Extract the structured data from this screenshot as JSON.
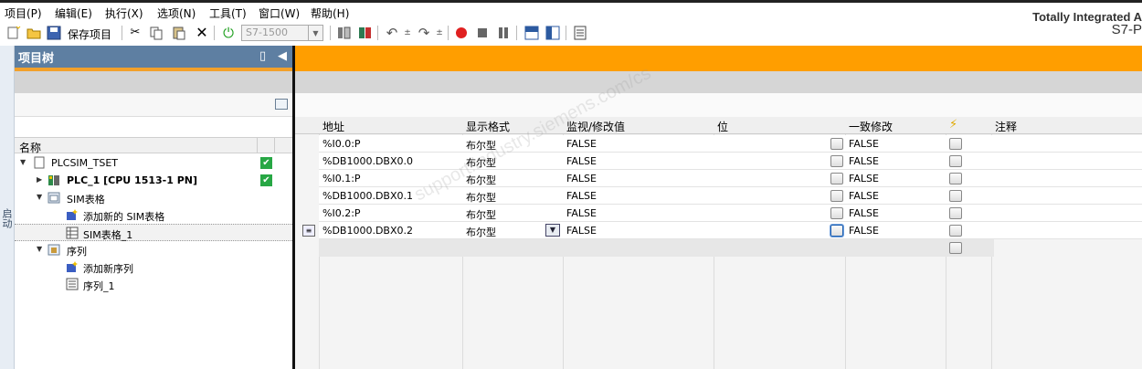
{
  "menubar": {
    "items": [
      "项目(P)",
      "编辑(E)",
      "执行(X)",
      "选项(N)",
      "工具(T)",
      "窗口(W)",
      "帮助(H)"
    ]
  },
  "brand": {
    "line1": "Totally Integrated A",
    "line2": "S7-P"
  },
  "toolbar": {
    "save_label": "保存项目",
    "device_select": "S7-1500"
  },
  "sidetab": {
    "label": "启动"
  },
  "project_tree": {
    "title": "项目树",
    "column_header": "名称",
    "items": [
      {
        "label": "PLCSIM_TSET",
        "level": 0,
        "expanded": true,
        "checked": true,
        "bold": false
      },
      {
        "label": "PLC_1 [CPU 1513-1 PN]",
        "level": 1,
        "expanded": false,
        "checked": true,
        "bold": true
      },
      {
        "label": "SIM表格",
        "level": 1,
        "expanded": true,
        "checked": false,
        "bold": false
      },
      {
        "label": "添加新的 SIM表格",
        "level": 2,
        "expanded": null,
        "checked": false,
        "bold": false
      },
      {
        "label": "SIM表格_1",
        "level": 2,
        "expanded": null,
        "checked": false,
        "bold": false,
        "selected": true
      },
      {
        "label": "序列",
        "level": 1,
        "expanded": true,
        "checked": false,
        "bold": false
      },
      {
        "label": "添加新序列",
        "level": 2,
        "expanded": null,
        "checked": false,
        "bold": false
      },
      {
        "label": "序列_1",
        "level": 2,
        "expanded": null,
        "checked": false,
        "bold": false
      }
    ]
  },
  "table": {
    "headers": {
      "address": "地址",
      "format": "显示格式",
      "monitor": "监视/修改值",
      "bit": "位",
      "consistent": "一致修改",
      "lightning": "⚡",
      "comment": "注释"
    },
    "rows": [
      {
        "address": "%I0.0:P",
        "format": "布尔型",
        "monitor": "FALSE",
        "consistent": "FALSE"
      },
      {
        "address": "%DB1000.DBX0.0",
        "format": "布尔型",
        "monitor": "FALSE",
        "consistent": "FALSE"
      },
      {
        "address": "%I0.1:P",
        "format": "布尔型",
        "monitor": "FALSE",
        "consistent": "FALSE"
      },
      {
        "address": "%DB1000.DBX0.1",
        "format": "布尔型",
        "monitor": "FALSE",
        "consistent": "FALSE"
      },
      {
        "address": "%I0.2:P",
        "format": "布尔型",
        "monitor": "FALSE",
        "consistent": "FALSE"
      },
      {
        "address": "%DB1000.DBX0.2",
        "format": "布尔型",
        "monitor": "FALSE",
        "consistent": "FALSE"
      }
    ]
  },
  "watermark": "support.industry.siemens.com/cs"
}
